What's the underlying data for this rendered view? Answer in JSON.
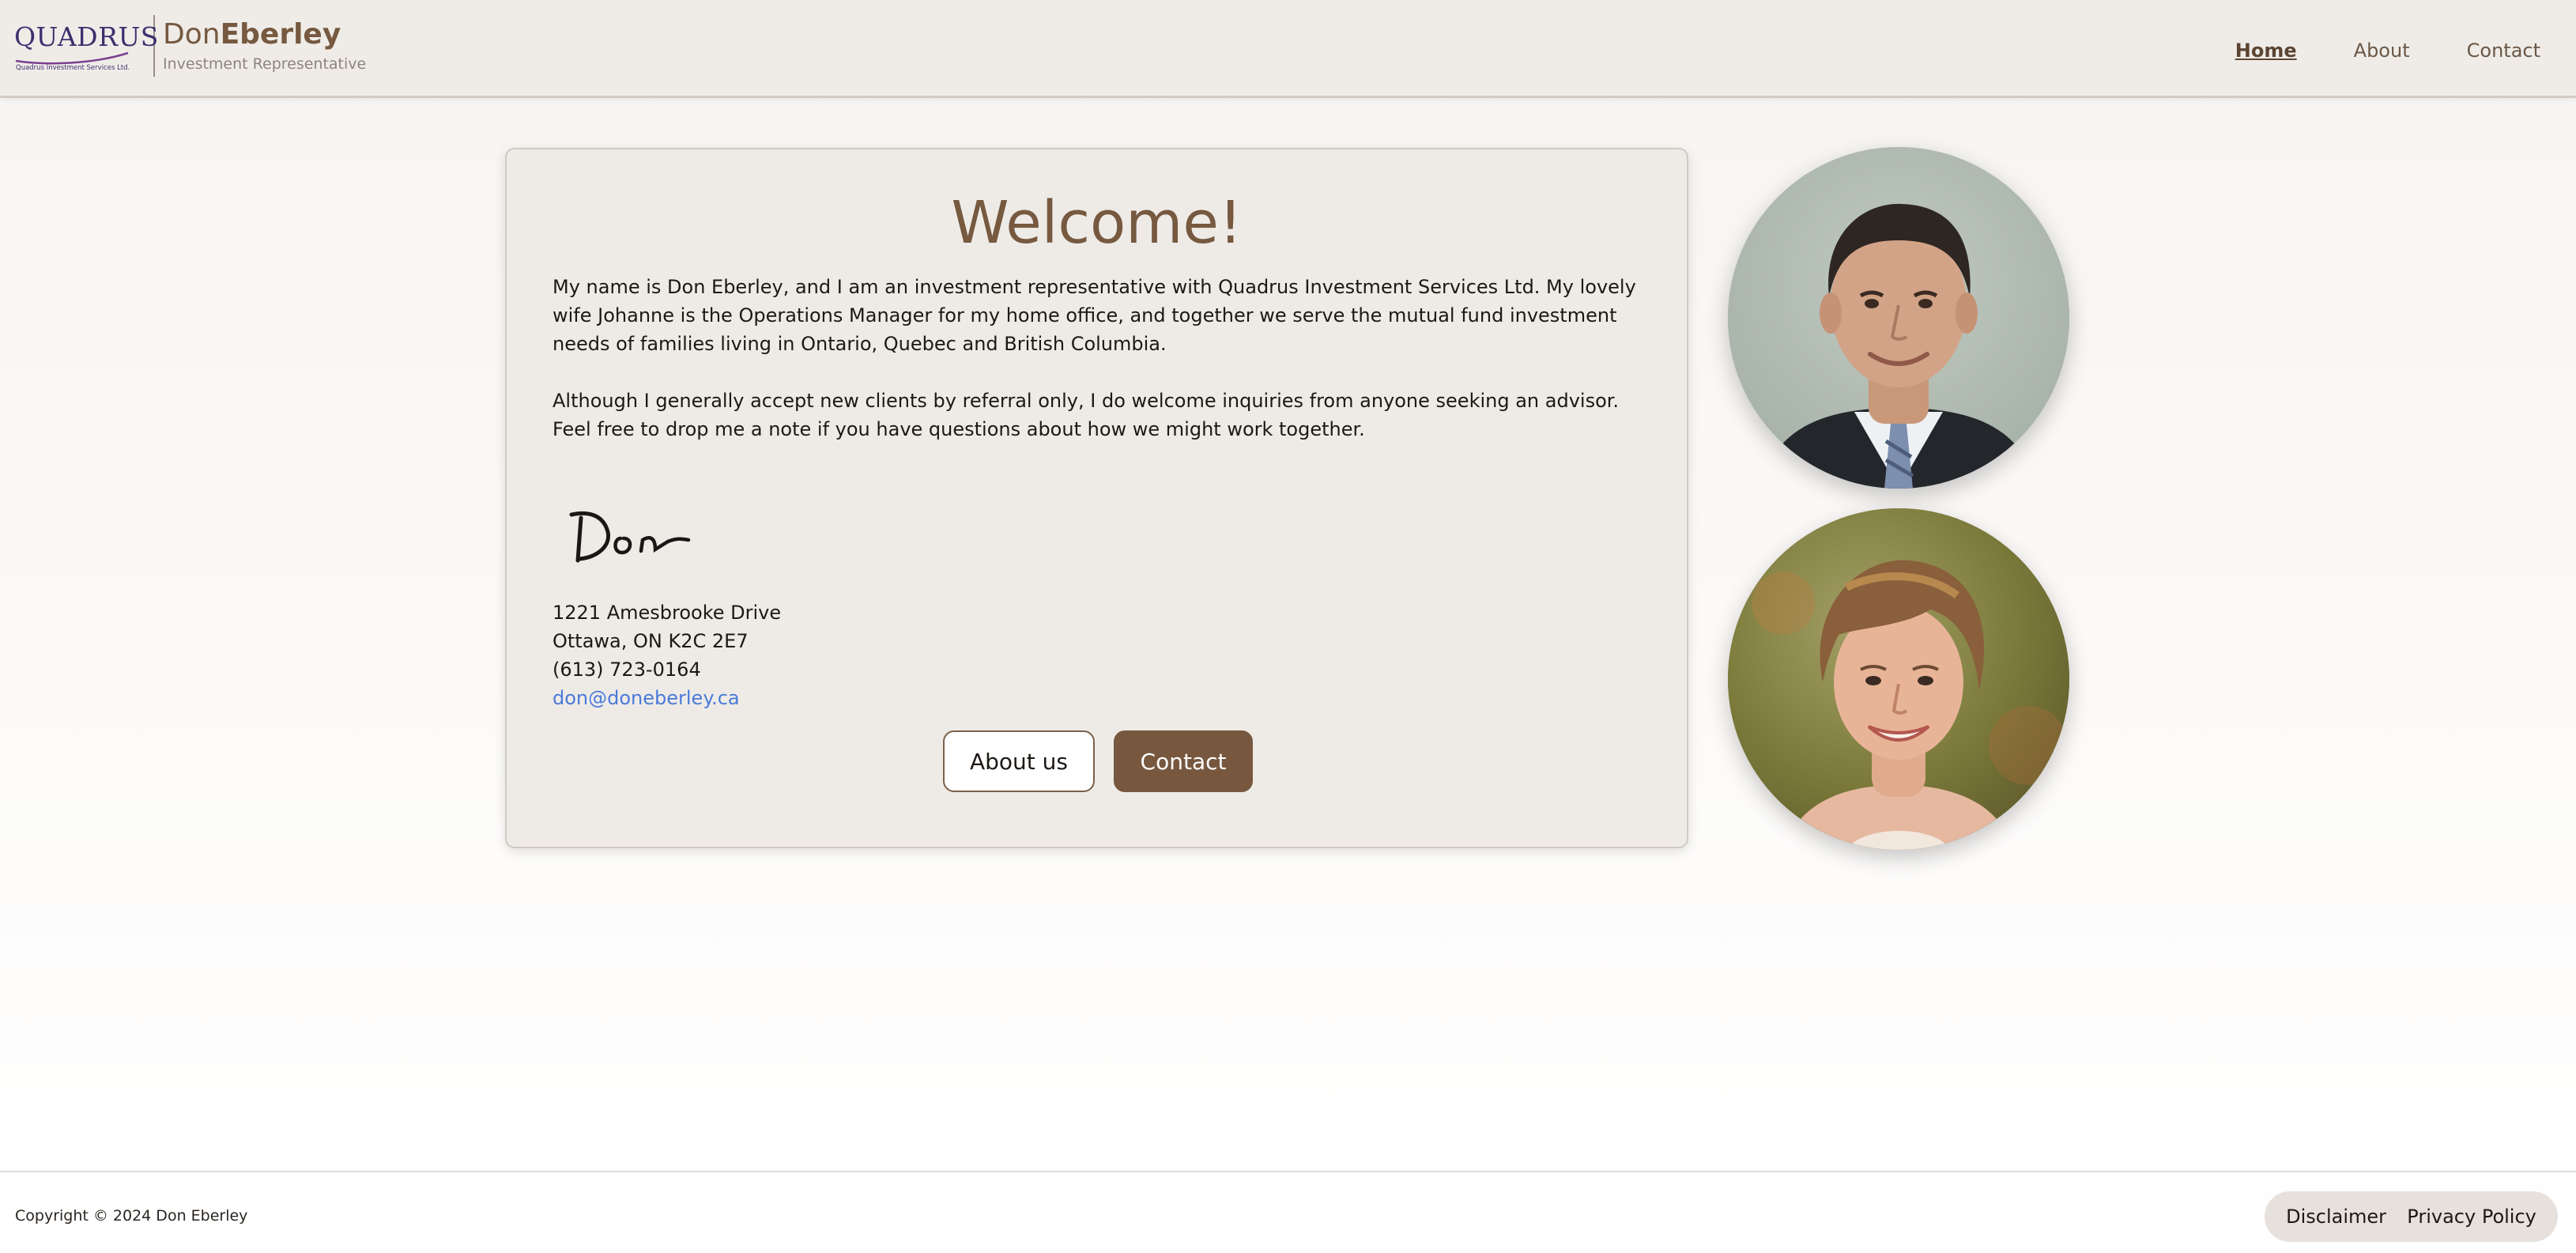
{
  "header": {
    "logo": {
      "wordmark": "QUADRUS",
      "subtitle": "Quadrus Investment Services Ltd."
    },
    "brand": {
      "first_name": "Don",
      "last_name": "Eberley",
      "role": "Investment Representative"
    },
    "nav": [
      {
        "label": "Home",
        "active": true
      },
      {
        "label": "About",
        "active": false
      },
      {
        "label": "Contact",
        "active": false
      }
    ]
  },
  "main": {
    "title": "Welcome!",
    "paragraphs": [
      "My name is Don Eberley, and I am an investment representative with Quadrus Investment Services Ltd. My lovely wife Johanne is the Operations Manager for my home office, and together we serve the mutual fund investment needs of families living in Ontario, Quebec and British Columbia.",
      "Although I generally accept new clients by referral only, I do welcome inquiries from anyone seeking an advisor. Feel free to drop me a note if you have questions about how we might work together."
    ],
    "signature": "Don",
    "address": {
      "street": "1221 Amesbrooke Drive",
      "city": "Ottawa, ON K2C 2E7",
      "phone": "(613) 723-0164",
      "email": "don@doneberley.ca"
    },
    "buttons": {
      "about": "About us",
      "contact": "Contact"
    }
  },
  "footer": {
    "copyright": "Copyright © 2024 Don Eberley",
    "links": [
      "Disclaimer",
      "Privacy Policy"
    ]
  },
  "colors": {
    "brand_brown": "#76593f",
    "header_bg": "#efece8",
    "card_bg": "#eeebe7",
    "link_blue": "#4a7ad9",
    "quadrus_purple": "#3e2f6e"
  }
}
